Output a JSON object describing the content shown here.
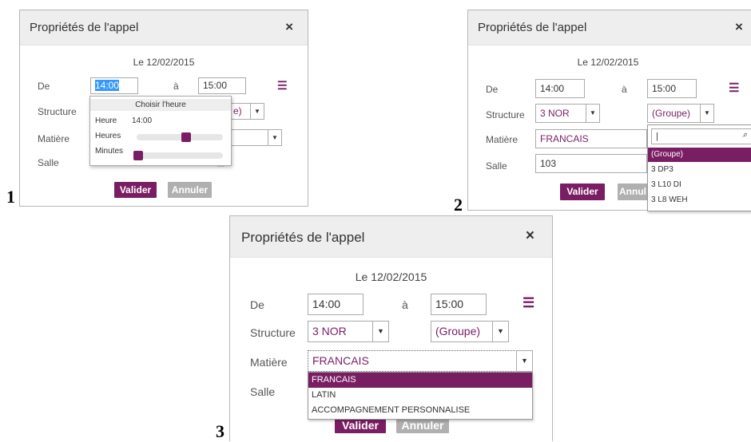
{
  "dialog1": {
    "title": "Propriétés de l'appel",
    "close": "×",
    "date": "Le 12/02/2015",
    "de_label": "De",
    "de_value": "14:00",
    "a_label": "à",
    "a_value": "15:00",
    "structure_label": "Structure",
    "groupe_partial": "e)",
    "matiere_label": "Matière",
    "salle_label": "Salle",
    "valider": "Valider",
    "annuler": "Annuler",
    "time_picker": {
      "title": "Choisir l'heure",
      "heure_label": "Heure",
      "heure_value": "14:00",
      "heures_label": "Heures",
      "minutes_label": "Minutes",
      "hours_level": 0.58,
      "minutes_level": 0.0
    },
    "number": "1"
  },
  "dialog2": {
    "title": "Propriétés de l'appel",
    "close": "×",
    "date": "Le 12/02/2015",
    "de_label": "De",
    "de_value": "14:00",
    "a_label": "à",
    "a_value": "15:00",
    "structure_label": "Structure",
    "structure_value": "3 NOR",
    "groupe_value": "(Groupe)",
    "matiere_label": "Matière",
    "matiere_value": "FRANCAIS",
    "salle_label": "Salle",
    "salle_value": "103",
    "valider": "Valider",
    "annuler_partial": "Annul",
    "groupe_options": [
      "(Groupe)",
      "3 DP3",
      "3 L10 DI",
      "3 L8 WEH"
    ],
    "number": "2"
  },
  "dialog3": {
    "title": "Propriétés de l'appel",
    "close": "×",
    "date": "Le 12/02/2015",
    "de_label": "De",
    "de_value": "14:00",
    "a_label": "à",
    "a_value": "15:00",
    "structure_label": "Structure",
    "structure_value": "3 NOR",
    "groupe_value": "(Groupe)",
    "matiere_label": "Matière",
    "matiere_value": "FRANCAIS",
    "salle_label": "Salle",
    "valider": "Valider",
    "annuler": "Annuler",
    "matiere_options": [
      "FRANCAIS",
      "LATIN",
      "ACCOMPAGNEMENT PERSONNALISE"
    ],
    "number": "3"
  },
  "colors": {
    "accent": "#7a1e64",
    "cancel": "#b0b0b0",
    "header": "#eeeeee",
    "selection": "#3399ff"
  },
  "icons": {
    "close": "close-icon",
    "list": "list-icon",
    "caret": "chevron-down-icon",
    "search": "search-icon"
  }
}
